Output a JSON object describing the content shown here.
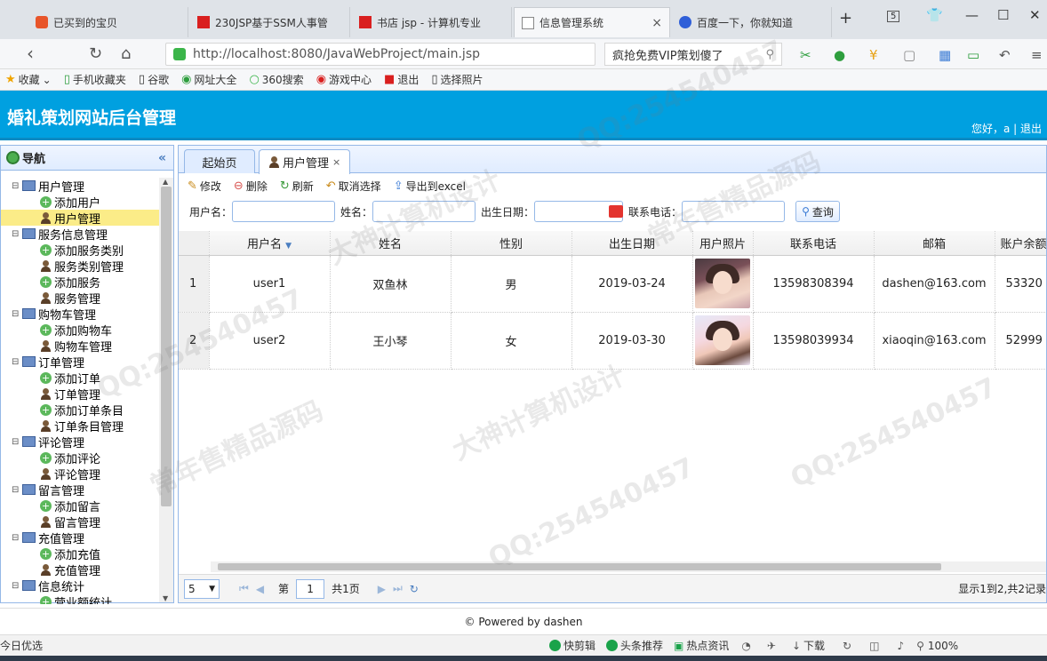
{
  "browser": {
    "tabs": [
      {
        "label": "已买到的宝贝",
        "active": false
      },
      {
        "label": "230JSP基于SSM人事管",
        "active": false
      },
      {
        "label": "书店 jsp - 计算机专业",
        "active": false
      },
      {
        "label": "信息管理系统",
        "active": true
      },
      {
        "label": "百度一下，你就知道",
        "active": false
      }
    ],
    "new_tab": "+",
    "tab_count": "5",
    "url": "http://localhost:8080/JavaWebProject/main.jsp",
    "search_text": "疯抢免费VIP策划傻了",
    "bookmarks": [
      "收藏",
      "手机收藏夹",
      "谷歌",
      "网址大全",
      "360搜索",
      "游戏中心",
      "退出",
      "选择照片"
    ]
  },
  "app": {
    "title": "婚礼策划网站后台管理",
    "user_greeting": "您好，a | 退出"
  },
  "nav": {
    "title": "导航",
    "tree": [
      {
        "type": "group",
        "label": "用户管理"
      },
      {
        "type": "add",
        "label": "添加用户"
      },
      {
        "type": "manage",
        "label": "用户管理",
        "selected": true
      },
      {
        "type": "group",
        "label": "服务信息管理"
      },
      {
        "type": "add",
        "label": "添加服务类别"
      },
      {
        "type": "manage",
        "label": "服务类别管理"
      },
      {
        "type": "add",
        "label": "添加服务"
      },
      {
        "type": "manage",
        "label": "服务管理"
      },
      {
        "type": "group",
        "label": "购物车管理"
      },
      {
        "type": "add",
        "label": "添加购物车"
      },
      {
        "type": "manage",
        "label": "购物车管理"
      },
      {
        "type": "group",
        "label": "订单管理"
      },
      {
        "type": "add",
        "label": "添加订单"
      },
      {
        "type": "manage",
        "label": "订单管理"
      },
      {
        "type": "add",
        "label": "添加订单条目"
      },
      {
        "type": "manage",
        "label": "订单条目管理"
      },
      {
        "type": "group",
        "label": "评论管理"
      },
      {
        "type": "add",
        "label": "添加评论"
      },
      {
        "type": "manage",
        "label": "评论管理"
      },
      {
        "type": "group",
        "label": "留言管理"
      },
      {
        "type": "add",
        "label": "添加留言"
      },
      {
        "type": "manage",
        "label": "留言管理"
      },
      {
        "type": "group",
        "label": "充值管理"
      },
      {
        "type": "add",
        "label": "添加充值"
      },
      {
        "type": "manage",
        "label": "充值管理"
      },
      {
        "type": "group",
        "label": "信息统计"
      },
      {
        "type": "add",
        "label": "营业额统计"
      }
    ]
  },
  "main": {
    "tabs": [
      {
        "label": "起始页",
        "active": false
      },
      {
        "label": "用户管理",
        "active": true,
        "close": "×"
      }
    ],
    "toolbar": {
      "edit": "修改",
      "delete": "删除",
      "refresh": "刷新",
      "unselect": "取消选择",
      "export": "导出到excel"
    },
    "search": {
      "username_label": "用户名：",
      "name_label": "姓名：",
      "birth_label": "出生日期：",
      "phone_label": "联系电话：",
      "button": "查询"
    },
    "grid": {
      "columns": [
        "用户名",
        "姓名",
        "性别",
        "出生日期",
        "用户照片",
        "联系电话",
        "邮箱",
        "账户余额"
      ],
      "rows": [
        {
          "num": "1",
          "username": "user1",
          "name": "双鱼林",
          "gender": "男",
          "birth": "2019-03-24",
          "phone": "13598308394",
          "email": "dashen@163.com",
          "balance": "53320"
        },
        {
          "num": "2",
          "username": "user2",
          "name": "王小琴",
          "gender": "女",
          "birth": "2019-03-30",
          "phone": "13598039934",
          "email": "xiaoqin@163.com",
          "balance": "52999"
        }
      ]
    },
    "pager": {
      "page_size": "5",
      "page_prefix": "第",
      "page": "1",
      "page_suffix": "共1页",
      "info": "显示1到2,共2记录"
    }
  },
  "footer": "© Powered by dashen",
  "statusbar": {
    "left": "今日优选",
    "items": [
      "快剪辑",
      "头条推荐",
      "热点资讯",
      "下载"
    ],
    "zoom": "100%"
  },
  "watermarks": [
    "QQ:254540457",
    "大神计算机设计",
    "常年售精品源码"
  ],
  "colors": {
    "header": "#00a0e0",
    "panel_border": "#95b8e7",
    "selected": "#fbec88"
  }
}
